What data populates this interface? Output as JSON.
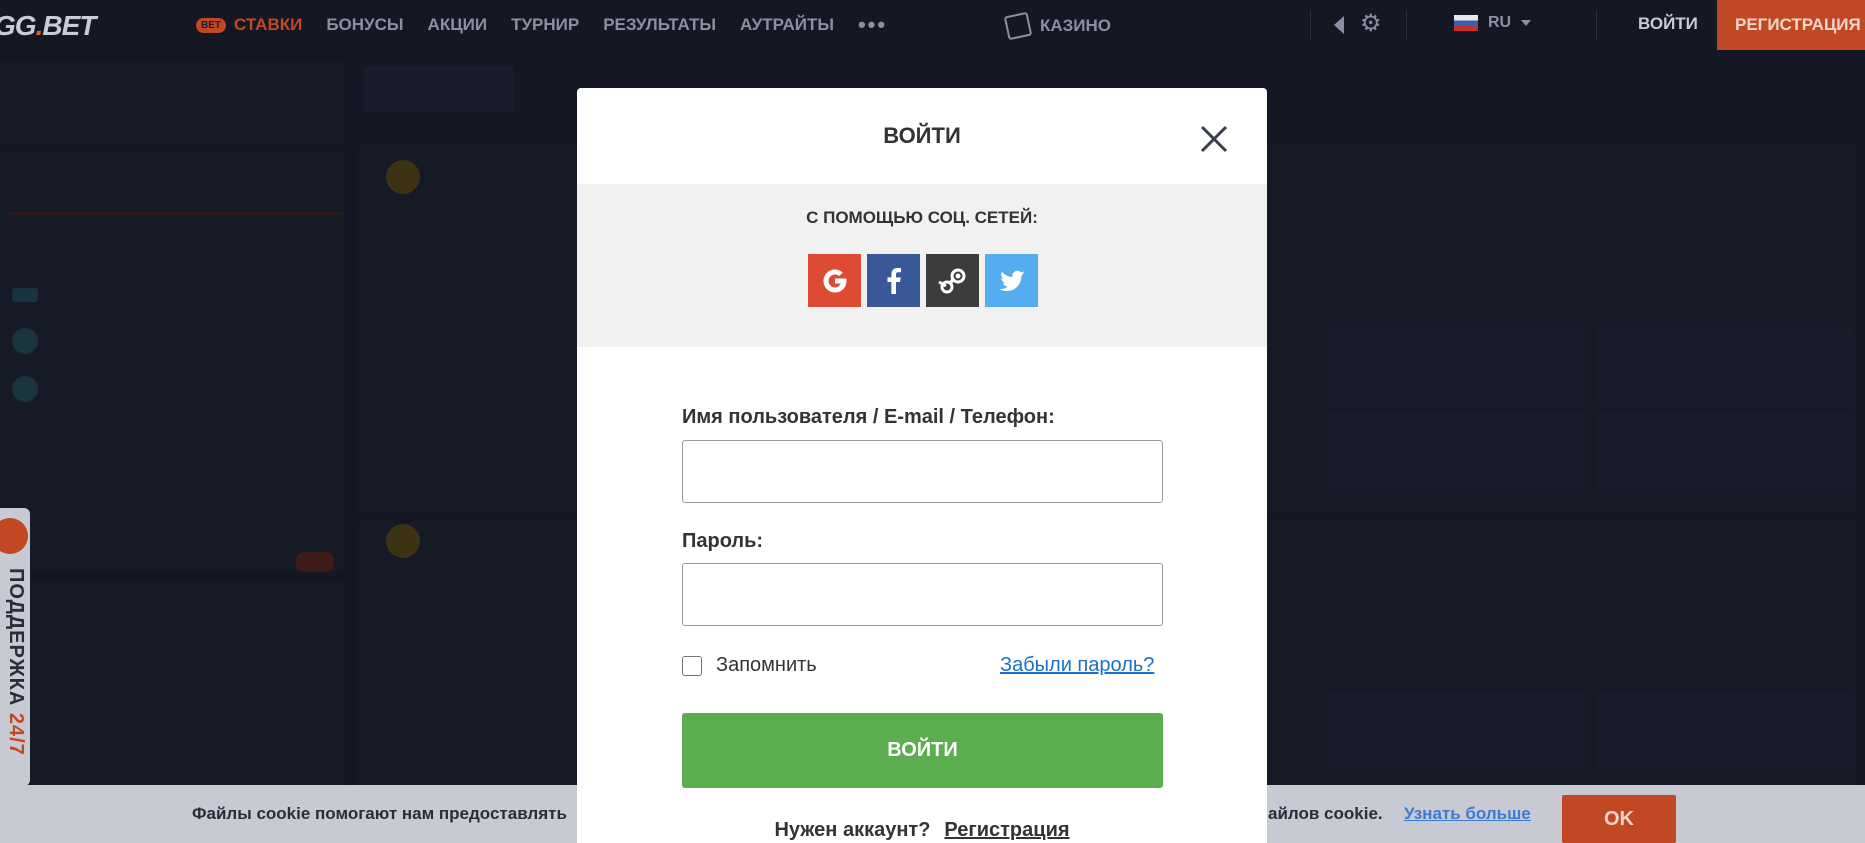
{
  "header": {
    "logo": "GG.BET",
    "nav": {
      "bet_badge": "BET",
      "stavki": "СТАВКИ",
      "bonuses": "БОНУСЫ",
      "promos": "АКЦИИ",
      "tournament": "ТУРНИР",
      "results": "РЕЗУЛЬТАТЫ",
      "outrights": "АУТРАЙТЫ",
      "more": "•••"
    },
    "casino": "КАЗИНО",
    "language": "RU",
    "login": "ВОЙТИ",
    "register": "РЕГИСТРАЦИЯ"
  },
  "modal": {
    "title": "ВОЙТИ",
    "social_title": "С ПОМОЩЬЮ СОЦ. СЕТЕЙ:",
    "social": [
      "google-icon",
      "facebook-icon",
      "steam-icon",
      "twitter-icon"
    ],
    "username_label": "Имя пользователя / E-mail / Телефон:",
    "username_value": "",
    "password_label": "Пароль:",
    "password_value": "",
    "remember_label": "Запомнить",
    "remember_checked": false,
    "forgot_label": "Забыли пароль?",
    "submit_label": "ВОЙТИ",
    "need_account": "Нужен аккаунт?",
    "register_link": "Регистрация"
  },
  "support": {
    "label": "ПОДДЕРЖКА",
    "hours": "24/7"
  },
  "cookie": {
    "text_start": "Файлы cookie помогают нам предоставлять",
    "text_end": "айлов cookie.",
    "more": "Узнать больше",
    "ok": "OK"
  },
  "colors": {
    "accent": "#c24824",
    "submit": "#5bad4f",
    "link": "#1a6fcf",
    "google": "#df4a32",
    "facebook": "#3b5998",
    "steam": "#3c3c3c",
    "twitter": "#55acee"
  }
}
